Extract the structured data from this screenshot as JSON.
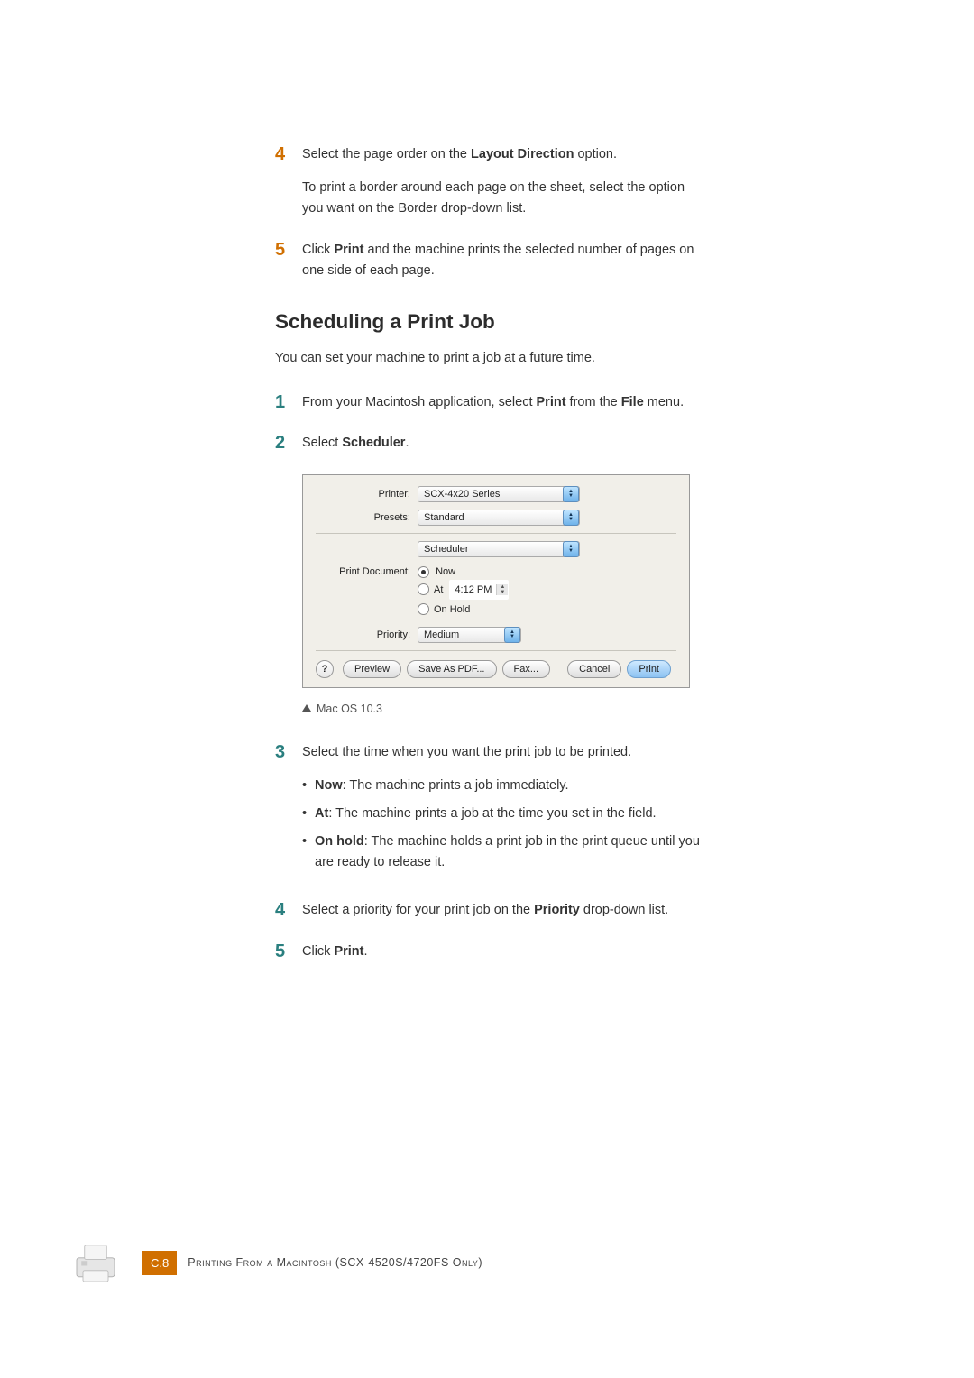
{
  "steps_a": [
    {
      "num": "4",
      "paragraphs": [
        "Select the page order on the <b>Layout Direction</b> option.",
        "To print a border around each page on the sheet, select the option you want on the Border drop-down list."
      ]
    },
    {
      "num": "5",
      "paragraphs": [
        "Click <b>Print</b> and the machine prints the selected number of pages on one side of each page."
      ]
    }
  ],
  "section_heading": "Scheduling a Print Job",
  "section_intro": "You can set your machine to print a job at a future time.",
  "steps_b_first": [
    {
      "num": "1",
      "paragraphs": [
        "From your Macintosh application, select <b>Print</b> from the <b>File</b> menu."
      ]
    },
    {
      "num": "2",
      "paragraphs": [
        "Select <b>Scheduler</b>."
      ]
    }
  ],
  "dialog": {
    "printer_label": "Printer:",
    "printer_value": "SCX-4x20 Series",
    "presets_label": "Presets:",
    "presets_value": "Standard",
    "pane_value": "Scheduler",
    "print_doc_label": "Print Document:",
    "opt_now": "Now",
    "opt_at": "At",
    "opt_at_time": "4:12 PM",
    "opt_onhold": "On Hold",
    "priority_label": "Priority:",
    "priority_value": "Medium",
    "btn_help": "?",
    "btn_preview": "Preview",
    "btn_savepdf": "Save As PDF...",
    "btn_fax": "Fax...",
    "btn_cancel": "Cancel",
    "btn_print": "Print"
  },
  "caption": "Mac OS 10.3",
  "step3": {
    "num": "3",
    "lead": "Select the time when you want the print job to be printed.",
    "bullets": [
      "<b>Now</b>: The machine prints a job immediately.",
      "<b>At</b>: The machine prints a job at the time you set in the field.",
      "<b>On hold</b>: The machine holds a print job in the print queue until you are ready to release it."
    ]
  },
  "steps_b_last": [
    {
      "num": "4",
      "paragraphs": [
        "Select a priority for your print job on the <b>Priority</b> drop-down list."
      ]
    },
    {
      "num": "5",
      "paragraphs": [
        "Click <b>Print</b>."
      ]
    }
  ],
  "footer": {
    "page_badge": "C.8",
    "text_pre": "Printing From a Macintosh ",
    "text_model": "(SCX-4520S/4720FS Only)"
  }
}
